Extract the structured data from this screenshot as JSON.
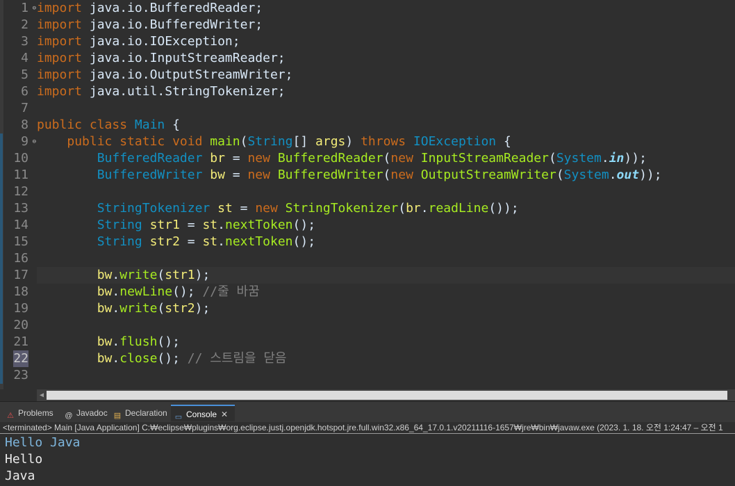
{
  "editor": {
    "lines": [
      {
        "n": "1",
        "fold": true,
        "segs": [
          [
            "kw",
            "import"
          ],
          [
            "pl",
            " java.io.BufferedReader;"
          ]
        ]
      },
      {
        "n": "2",
        "segs": [
          [
            "kw",
            "import"
          ],
          [
            "pl",
            " java.io.BufferedWriter;"
          ]
        ]
      },
      {
        "n": "3",
        "segs": [
          [
            "kw",
            "import"
          ],
          [
            "pl",
            " java.io.IOException;"
          ]
        ]
      },
      {
        "n": "4",
        "segs": [
          [
            "kw",
            "import"
          ],
          [
            "pl",
            " java.io.InputStreamReader;"
          ]
        ]
      },
      {
        "n": "5",
        "segs": [
          [
            "kw",
            "import"
          ],
          [
            "pl",
            " java.io.OutputStreamWriter;"
          ]
        ]
      },
      {
        "n": "6",
        "segs": [
          [
            "kw",
            "import"
          ],
          [
            "pl",
            " java.util.StringTokenizer;"
          ]
        ]
      },
      {
        "n": "7",
        "segs": []
      },
      {
        "n": "8",
        "segs": [
          [
            "kw",
            "public class "
          ],
          [
            "tp",
            "Main"
          ],
          [
            "pl",
            " {"
          ]
        ]
      },
      {
        "n": "9",
        "fold": true,
        "mark": true,
        "segs": [
          [
            "pl",
            "    "
          ],
          [
            "kw",
            "public static void "
          ],
          [
            "fn",
            "main"
          ],
          [
            "pl",
            "("
          ],
          [
            "tp",
            "String"
          ],
          [
            "pl",
            "[] "
          ],
          [
            "var",
            "args"
          ],
          [
            "pl",
            ") "
          ],
          [
            "kw",
            "throws "
          ],
          [
            "tp",
            "IOException"
          ],
          [
            "pl",
            " {"
          ]
        ]
      },
      {
        "n": "10",
        "mark": true,
        "segs": [
          [
            "pl",
            "        "
          ],
          [
            "tp",
            "BufferedReader"
          ],
          [
            "pl",
            " "
          ],
          [
            "var",
            "br"
          ],
          [
            "pl",
            " = "
          ],
          [
            "kw",
            "new "
          ],
          [
            "fn",
            "BufferedReader"
          ],
          [
            "pl",
            "("
          ],
          [
            "kw",
            "new "
          ],
          [
            "fn",
            "InputStreamReader"
          ],
          [
            "pl",
            "("
          ],
          [
            "tp",
            "System"
          ],
          [
            "pl",
            "."
          ],
          [
            "sf",
            "in"
          ],
          [
            "pl",
            "));"
          ]
        ]
      },
      {
        "n": "11",
        "mark": true,
        "segs": [
          [
            "pl",
            "        "
          ],
          [
            "tp",
            "BufferedWriter"
          ],
          [
            "pl",
            " "
          ],
          [
            "var",
            "bw"
          ],
          [
            "pl",
            " = "
          ],
          [
            "kw",
            "new "
          ],
          [
            "fn",
            "BufferedWriter"
          ],
          [
            "pl",
            "("
          ],
          [
            "kw",
            "new "
          ],
          [
            "fn",
            "OutputStreamWriter"
          ],
          [
            "pl",
            "("
          ],
          [
            "tp",
            "System"
          ],
          [
            "pl",
            "."
          ],
          [
            "sf",
            "out"
          ],
          [
            "pl",
            "));"
          ]
        ]
      },
      {
        "n": "12",
        "mark": true,
        "segs": []
      },
      {
        "n": "13",
        "mark": true,
        "segs": [
          [
            "pl",
            "        "
          ],
          [
            "tp",
            "StringTokenizer"
          ],
          [
            "pl",
            " "
          ],
          [
            "var",
            "st"
          ],
          [
            "pl",
            " = "
          ],
          [
            "kw",
            "new "
          ],
          [
            "fn",
            "StringTokenizer"
          ],
          [
            "pl",
            "("
          ],
          [
            "var",
            "br"
          ],
          [
            "pl",
            "."
          ],
          [
            "fn",
            "readLine"
          ],
          [
            "pl",
            "());"
          ]
        ]
      },
      {
        "n": "14",
        "mark": true,
        "segs": [
          [
            "pl",
            "        "
          ],
          [
            "tp",
            "String"
          ],
          [
            "pl",
            " "
          ],
          [
            "var",
            "str1"
          ],
          [
            "pl",
            " = "
          ],
          [
            "var",
            "st"
          ],
          [
            "pl",
            "."
          ],
          [
            "fn",
            "nextToken"
          ],
          [
            "pl",
            "();"
          ]
        ]
      },
      {
        "n": "15",
        "mark": true,
        "segs": [
          [
            "pl",
            "        "
          ],
          [
            "tp",
            "String"
          ],
          [
            "pl",
            " "
          ],
          [
            "var",
            "str2"
          ],
          [
            "pl",
            " = "
          ],
          [
            "var",
            "st"
          ],
          [
            "pl",
            "."
          ],
          [
            "fn",
            "nextToken"
          ],
          [
            "pl",
            "();"
          ]
        ]
      },
      {
        "n": "16",
        "mark": true,
        "segs": []
      },
      {
        "n": "17",
        "mark": true,
        "current": true,
        "segs": [
          [
            "pl",
            "        "
          ],
          [
            "var",
            "bw"
          ],
          [
            "pl",
            "."
          ],
          [
            "fn",
            "write"
          ],
          [
            "pl",
            "("
          ],
          [
            "var",
            "str1"
          ],
          [
            "pl",
            ");"
          ]
        ]
      },
      {
        "n": "18",
        "mark": true,
        "segs": [
          [
            "pl",
            "        "
          ],
          [
            "var",
            "bw"
          ],
          [
            "pl",
            "."
          ],
          [
            "fn",
            "newLine"
          ],
          [
            "pl",
            "(); "
          ],
          [
            "cm",
            "//줄 바꿈"
          ]
        ]
      },
      {
        "n": "19",
        "mark": true,
        "segs": [
          [
            "pl",
            "        "
          ],
          [
            "var",
            "bw"
          ],
          [
            "pl",
            "."
          ],
          [
            "fn",
            "write"
          ],
          [
            "pl",
            "("
          ],
          [
            "var",
            "str2"
          ],
          [
            "pl",
            ");"
          ]
        ]
      },
      {
        "n": "20",
        "mark": true,
        "segs": []
      },
      {
        "n": "21",
        "mark": true,
        "segs": [
          [
            "pl",
            "        "
          ],
          [
            "var",
            "bw"
          ],
          [
            "pl",
            "."
          ],
          [
            "fn",
            "flush"
          ],
          [
            "pl",
            "();"
          ]
        ]
      },
      {
        "n": "22",
        "mark": true,
        "sel": true,
        "segs": [
          [
            "pl",
            "        "
          ],
          [
            "var",
            "bw"
          ],
          [
            "pl",
            "."
          ],
          [
            "fn",
            "close"
          ],
          [
            "pl",
            "(); "
          ],
          [
            "cm",
            "// 스트림을 닫음"
          ]
        ]
      },
      {
        "n": "23",
        "mark": true,
        "segs": []
      }
    ]
  },
  "views": {
    "tabs": [
      {
        "id": "problems",
        "label": "Problems",
        "icon": "problems-icon",
        "glyph": "⚠",
        "color": "#e05050"
      },
      {
        "id": "javadoc",
        "label": "Javadoc",
        "icon": "javadoc-icon",
        "glyph": "@",
        "color": "#d0d0d0"
      },
      {
        "id": "declaration",
        "label": "Declaration",
        "icon": "declaration-icon",
        "glyph": "▤",
        "color": "#e0b050"
      },
      {
        "id": "console",
        "label": "Console",
        "icon": "console-icon",
        "glyph": "▭",
        "color": "#6aa0d8",
        "active": true,
        "close": "✕"
      }
    ]
  },
  "console": {
    "status": "<terminated> Main [Java Application] C:₩eclipse₩plugins₩org.eclipse.justj.openjdk.hotspot.jre.full.win32.x86_64_17.0.1.v20211116-1657₩jre₩bin₩javaw.exe  (2023. 1. 18. 오전 1:24:47 – 오전 1",
    "input_line": "Hello Java",
    "output_lines": [
      "Hello",
      "Java"
    ]
  },
  "colors": {
    "keyword": "#cc6c1d",
    "type": "#1290c3",
    "method": "#a7ec21",
    "variable": "#f3ec79",
    "comment": "#808080",
    "console_input": "#7eb6dd"
  }
}
